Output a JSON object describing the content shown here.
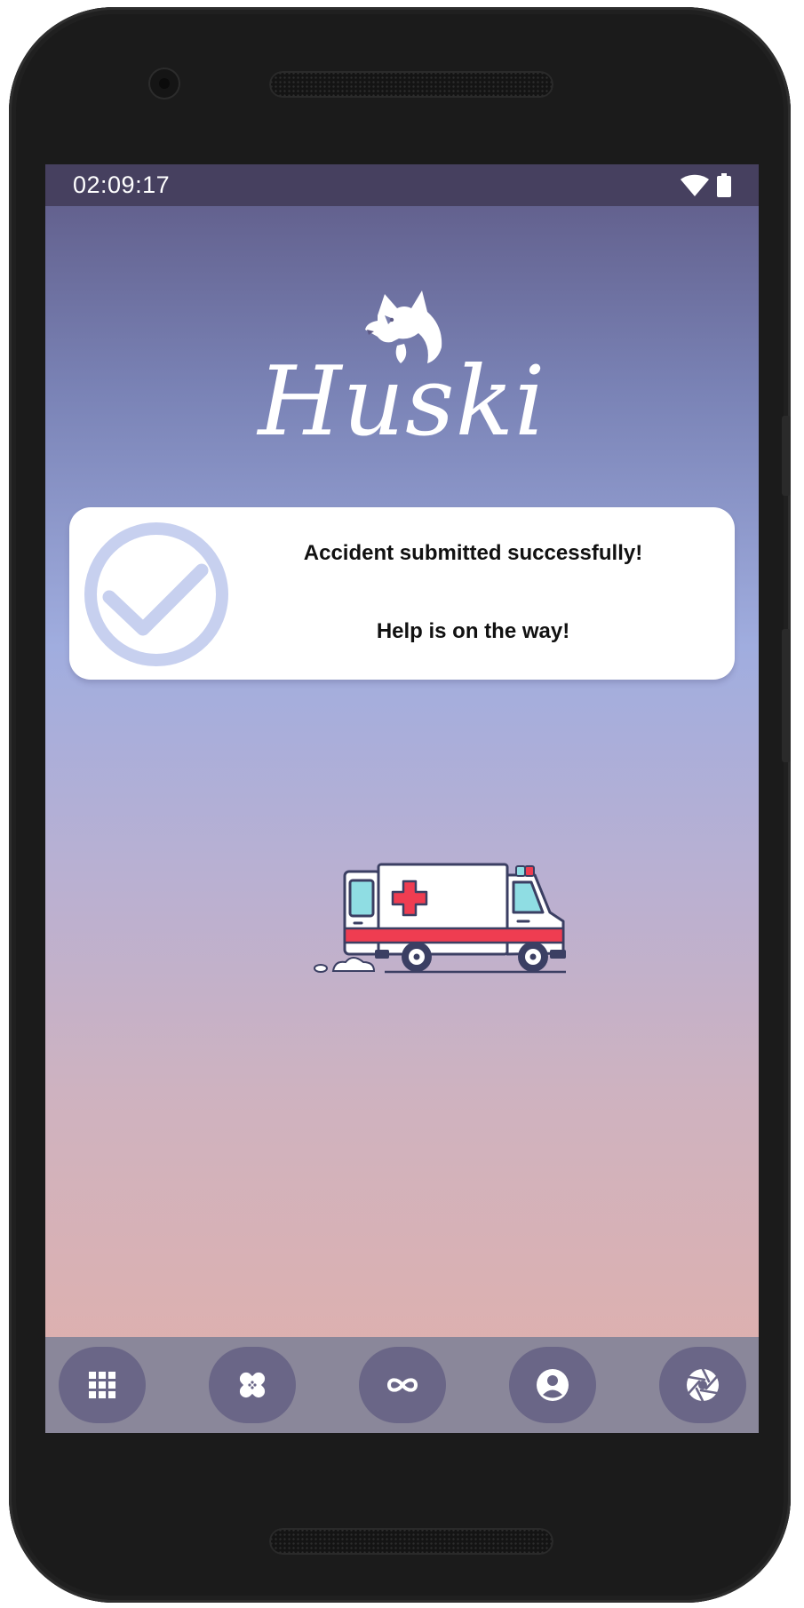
{
  "status_bar": {
    "time": "02:09:17",
    "icons": [
      "wifi-icon",
      "battery-icon"
    ]
  },
  "app": {
    "name": "Huski",
    "logo_icon": "husky-logo-icon"
  },
  "notification": {
    "icon": "checkmark-circle-icon",
    "title": "Accident submitted successfully!",
    "subtitle": "Help is on the way!"
  },
  "illustration": {
    "icon": "ambulance-illustration"
  },
  "bottom_nav": {
    "items": [
      {
        "icon": "grid-icon"
      },
      {
        "icon": "bandage-icon"
      },
      {
        "icon": "infinity-icon"
      },
      {
        "icon": "profile-icon"
      },
      {
        "icon": "camera-aperture-icon"
      }
    ]
  },
  "colors": {
    "status_bar": "#46405f",
    "nav_bar": "#8a879a",
    "nav_button": "#6a6687",
    "check_ring": "#c7d0ef",
    "gradient_top": "#5e5a86",
    "gradient_mid": "#a0addf",
    "gradient_bottom": "#e2b0aa"
  }
}
